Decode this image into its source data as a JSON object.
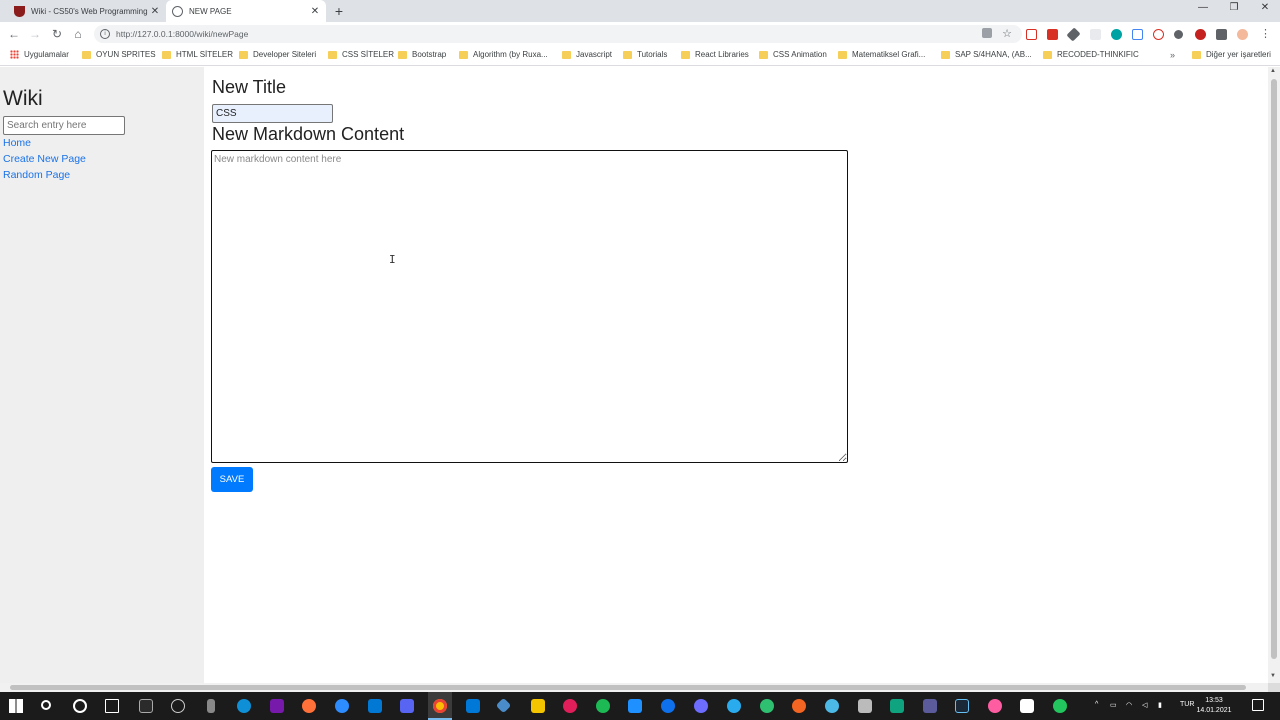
{
  "browser": {
    "tabs": [
      {
        "title": "Wiki - CS50's Web Programming",
        "active": false
      },
      {
        "title": "NEW PAGE",
        "active": true
      }
    ],
    "new_tab_icon": "plus-icon",
    "window_controls": {
      "minimize": "—",
      "restore": "❐",
      "close": "✕"
    },
    "url": "http://127.0.0.1:8000/wiki/newPage",
    "bookmarks": [
      "Uygulamalar",
      "OYUN SPRITES",
      "HTML SİTELER",
      "Developer Siteleri",
      "CSS SİTELER",
      "Bootstrap",
      "Algorithm (by Ruxa...",
      "Javascript",
      "Tutorials",
      "React Libraries",
      "CSS Animation",
      "Matematiksel Grafi...",
      "SAP S/4HANA, (AB...",
      "RECODED-THINKIFIC"
    ],
    "other_bookmarks": "Diğer yer işaretleri",
    "more_bookmarks": "»"
  },
  "sidebar": {
    "logo": "Wiki",
    "search_placeholder": "Search entry here",
    "links": [
      "Home",
      "Create New Page",
      "Random Page"
    ]
  },
  "form": {
    "title_heading": "New Title",
    "title_value": "CSS",
    "content_heading": "New Markdown Content",
    "content_placeholder": "New markdown content here",
    "content_value": "",
    "save_label": "SAVE"
  },
  "taskbar": {
    "language": "TUR",
    "time": "13:53",
    "date": "14.01.2021"
  },
  "colors": {
    "link": "#1a73e8",
    "save_button": "#007bff",
    "sidebar_bg": "#efefef",
    "autofill_bg": "#e8f0fe"
  }
}
